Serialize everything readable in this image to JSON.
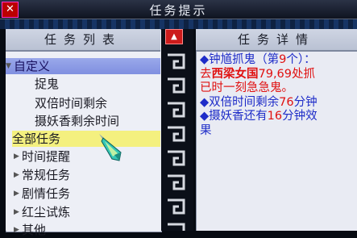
{
  "window": {
    "title": "任务提示",
    "close_glyph": "✕"
  },
  "left": {
    "header": "任务列表",
    "rows": [
      {
        "label": "自定义",
        "expanded": true
      },
      {
        "label": "捉鬼"
      },
      {
        "label": "双倍时间剩余"
      },
      {
        "label": "摄妖香剩余时间"
      },
      {
        "label": "全部任务"
      },
      {
        "label": "时间提醒"
      },
      {
        "label": "常规任务"
      },
      {
        "label": "剧情任务"
      },
      {
        "label": "红尘试炼"
      },
      {
        "label": "其他"
      }
    ],
    "scroll_up_glyph": "▲"
  },
  "right": {
    "header": "任务详情",
    "entries": [
      {
        "bullet": "◆",
        "title_prefix": "钟馗抓鬼（第",
        "title_count": "9",
        "title_suffix": "个）：",
        "line2_prefix": "去",
        "location": "西梁女国",
        "coords": "79,69",
        "line2_suffix": "处抓",
        "line3": "已时一刻急急鬼。"
      },
      {
        "bullet": "◆",
        "prefix": "双倍时间剩余",
        "value": "76",
        "suffix": "分钟"
      },
      {
        "bullet": "◆",
        "prefix": "摄妖香还有",
        "value": "16",
        "suffix": "分钟效",
        "cont": "果"
      }
    ]
  },
  "colors": {
    "accent_blue": "#1e2cc8",
    "accent_red": "#e01010",
    "selection_blue": "#8f9ce6",
    "selection_yellow": "#f4f07f"
  }
}
